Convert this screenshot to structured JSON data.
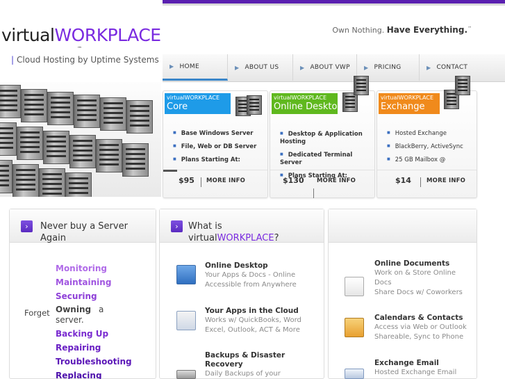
{
  "header": {
    "logo_prefix": "virtual",
    "logo_brand": "WORKPLACE",
    "logo_tm": "™",
    "tagline_bar": "|",
    "tagline": "Cloud Hosting by Uptime Systems",
    "motto_prefix": "Own Nothing.",
    "motto_bold": "Have Everything.",
    "motto_tm": "™"
  },
  "nav": {
    "items": [
      {
        "label": "HOME"
      },
      {
        "label": "ABOUT US"
      },
      {
        "label": "ABOUT VWP"
      },
      {
        "label": "PRICING"
      },
      {
        "label": "CONTACT"
      }
    ]
  },
  "cards": [
    {
      "title_small": "virtualWORKPLACE",
      "title_big": "Core",
      "color": "#1e9be8",
      "features": [
        "Base Windows Server",
        "File, Web or DB Server",
        "Plans Starting At:"
      ],
      "price": "$95",
      "more": "MORE INFO"
    },
    {
      "title_small": "virtualWORKPLACE",
      "title_big": "Online Desktop",
      "color": "#5fb81e",
      "features": [
        "Desktop & Application Hosting",
        "Dedicated Terminal Server",
        "Plans Starting At:"
      ],
      "price": "$130",
      "more": "MORE INFO"
    },
    {
      "title_small": "virtualWORKPLACE",
      "title_big": "Exchange",
      "color": "#f08a1c",
      "features": [
        "Hosted Exchange",
        "BlackBerry, ActiveSync",
        "25 GB Mailbox @"
      ],
      "price": "$14",
      "more": "MORE INFO"
    }
  ],
  "panel_left": {
    "badge": "›",
    "title_line1": "Never buy a Server",
    "title_line2": "Again",
    "forget": "Forget",
    "verbs_top": [
      {
        "text": "Monitoring",
        "color": "#b06be8"
      },
      {
        "text": "Maintaining",
        "color": "#a055e0"
      },
      {
        "text": "Securing",
        "color": "#8e3fd8"
      }
    ],
    "owning_word": "Owning",
    "owning_a": "a",
    "owning_rest": "server.",
    "verbs_bottom": [
      {
        "text": "Backing Up",
        "color": "#7a2bd0"
      },
      {
        "text": "Repairing",
        "color": "#6a20c4"
      },
      {
        "text": "Troubleshooting",
        "color": "#5c18b8"
      },
      {
        "text": "Replacing",
        "color": "#4e12ac"
      }
    ]
  },
  "panel_mid": {
    "badge": "›",
    "title_line1": "What is",
    "title_prefix": "virtual",
    "title_brand": "WORKPLACE",
    "title_q": "?",
    "features": [
      {
        "title": "Online Desktop",
        "desc": [
          "Your Apps & Docs - Online",
          "Accessible from Anywhere"
        ],
        "icon": "desktop-icon"
      },
      {
        "title": "Your Apps in the Cloud",
        "desc": [
          "Works w/ QuickBooks, Word",
          "Excel, Outlook, ACT & More"
        ],
        "icon": "cloud-apps-icon"
      },
      {
        "title": "Backups & Disaster",
        "title2": "Recovery",
        "desc": [
          "Daily Backups of your"
        ],
        "icon": "backup-icon"
      }
    ]
  },
  "panel_right": {
    "features": [
      {
        "title": "Online Documents",
        "desc": [
          "Work on & Store Online",
          "Docs",
          "Share Docs w/ Coworkers"
        ],
        "icon": "documents-icon"
      },
      {
        "title": "Calendars & Contacts",
        "desc": [
          "Access via Web or Outlook",
          "Shareable, Sync to Phone"
        ],
        "icon": "calendar-icon"
      },
      {
        "title": "Exchange Email",
        "desc": [
          "Hosted Exchange Email"
        ],
        "icon": "email-icon"
      }
    ]
  }
}
